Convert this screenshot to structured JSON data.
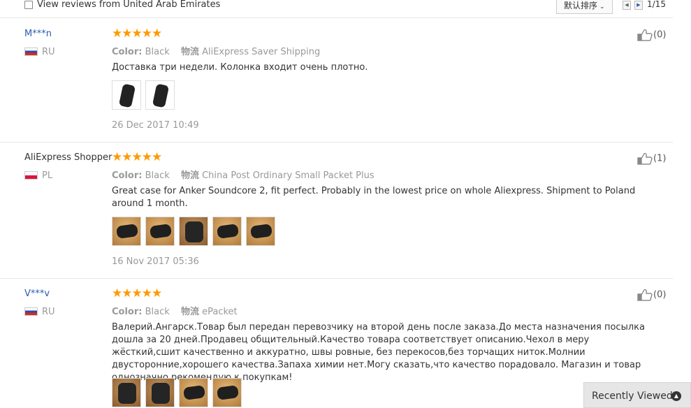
{
  "filter": {
    "label": "View reviews from United Arab Emirates",
    "checked": false
  },
  "sort": {
    "label": "默认排序",
    "chevron": "chevron-down-icon"
  },
  "pager": {
    "text": "1/15",
    "prev": "◀",
    "next": "▶"
  },
  "stars_glyph": "★★★★★",
  "reviews": [
    {
      "name": "M***n",
      "country": "RU",
      "stars": 5,
      "color_label": "Color:",
      "color_value": "Black",
      "shipping_label": "物流",
      "shipping_value": "AliExpress Saver Shipping",
      "text": "Доставка три недели. Колонка входит очень плотно.",
      "photos": 2,
      "date": "26 Dec 2017 10:49",
      "likes": "(0)"
    },
    {
      "name": "AliExpress Shopper",
      "country": "PL",
      "stars": 5,
      "color_label": "Color:",
      "color_value": "Black",
      "shipping_label": "物流",
      "shipping_value": "China Post Ordinary Small Packet Plus",
      "text": "Great case for Anker Soundcore 2, fit perfect. Probably in the lowest price on whole Aliexpress. Shipment to Poland around 1 month.",
      "photos": 5,
      "date": "16 Nov 2017 05:36",
      "likes": "(1)"
    },
    {
      "name": "V***v",
      "country": "RU",
      "stars": 5,
      "color_label": "Color:",
      "color_value": "Black",
      "shipping_label": "物流",
      "shipping_value": "ePacket",
      "text": "Валерий.Ангарск.Товар был передан перевозчику на второй день после заказа.До места назначения посылка дошла за 20 дней.Продавец общительный.Качество товара соответствует описанию.Чехол в меру жёсткий,сшит качественно и аккуратно, швы ровные, без перекосов,без торчащих ниток.Молнии двусторонние,хорошего качества.Запаха химии нет.Могу сказать,что качество порадовало. Магазин и товар однозначно рекомендую к покупкам!",
      "photos": 4,
      "likes": "(0)"
    }
  ],
  "recently_viewed": {
    "label": "Recently Viewed",
    "icon": "chevron-up-icon"
  },
  "colors": {
    "link": "#2a5db0",
    "star": "#ff9900",
    "muted": "#999999",
    "divider": "#e6e6e6"
  }
}
